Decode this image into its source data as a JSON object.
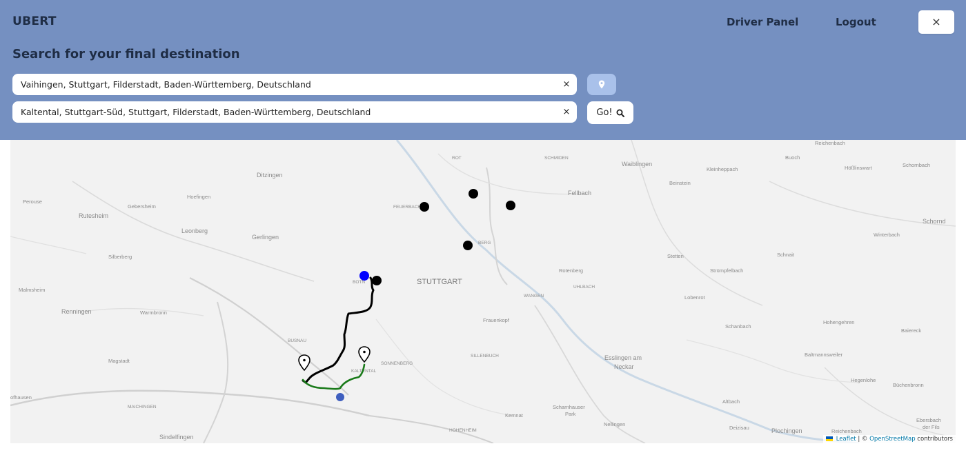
{
  "header": {
    "brand": "UBERT",
    "nav": {
      "driver_panel": "Driver Panel",
      "logout": "Logout"
    },
    "close_icon": "×"
  },
  "search": {
    "heading": "Search for your final destination",
    "origin_value": "Vaihingen, Stuttgart, Filderstadt, Baden-Württemberg, Deutschland",
    "destination_value": "Kaltental, Stuttgart-Süd, Stuttgart, Filderstadt, Baden-Württemberg, Deutschland",
    "clear_icon": "×",
    "locate_icon": "map-pin-icon",
    "go_label": "Go!",
    "go_icon": "search-icon"
  },
  "map": {
    "labels": {
      "ditzingen": "Ditzingen",
      "hoefingen": "Hoefingen",
      "gebersheim": "Gebersheim",
      "perouse": "Perouse",
      "rutesheim": "Rutesheim",
      "leonberg": "Leonberg",
      "gerlingen": "Gerlingen",
      "silberberg": "Silberberg",
      "malmsheim": "Malmsheim",
      "renningen": "Renningen",
      "warmbronn": "Warmbronn",
      "busnau": "BUSNAU",
      "magstadt": "Magstadt",
      "ofhausen": "ofhausen",
      "maichingen": "MAICHINGEN",
      "sindelfingen": "Sindelfingen",
      "stuttgart": "STUTTGART",
      "feuerbach": "FEUERBACH",
      "rot": "ROT",
      "berg": "BERG",
      "botnang": "BOTN",
      "schmiden": "SCHMIDEN",
      "waiblingen": "Waiblingen",
      "fellbach": "Fellbach",
      "kleinheppach": "Kleinheppach",
      "beinstein": "Beinstein",
      "buoch": "Buoch",
      "reichenbach_top": "Reichenbach",
      "hoesslinswart": "Hößlinswart",
      "schornbach": "Schornbach",
      "schorndorf": "Schornd",
      "winterbach": "Winterbach",
      "rotenberg": "Rotenberg",
      "uhlbach": "UHLBACH",
      "wangen": "WANGEN",
      "stetten": "Stetten",
      "struempfelbach": "Strümpfelbach",
      "schnait": "Schnait",
      "lobenrot": "Lobenrot",
      "frauenkopf": "Frauenkopf",
      "schanbach": "Schanbach",
      "hohengehren": "Hohengehren",
      "baiereck": "Baiereck",
      "sonnenberg": "SONNENBERG",
      "kaltental": "KALTENTAL",
      "sillenbuch": "SILLENBUCH",
      "esslingen": "Esslingen am",
      "neckar": "Neckar",
      "baltmannsweiler": "Baltmannsweiler",
      "hegenlohe": "Hegenlohe",
      "buechenbronn": "Büchenbronn",
      "scharnhauser": "Scharnhauser",
      "park": "Park",
      "altbach": "Altbach",
      "kemnat": "Kemnat",
      "hohenheim": "HOHENHEIM",
      "nellingen": "Nellingen",
      "deizisau": "Deizisau",
      "plochingen": "Plochingen",
      "reichenbach_bottom": "Reichenbach",
      "ebersbach": "Ebersbach",
      "der_fils": "der Fils"
    },
    "attribution": {
      "leaflet": "Leaflet",
      "separator": "| ©",
      "osm": "OpenStreetMap",
      "contributors": "contributors"
    }
  },
  "colors": {
    "header_bg": "#7590c1",
    "route_main": "#000000",
    "route_green": "#1a7a1a",
    "user_marker": "#0000ff",
    "destination_dot": "#3f5fbf"
  }
}
